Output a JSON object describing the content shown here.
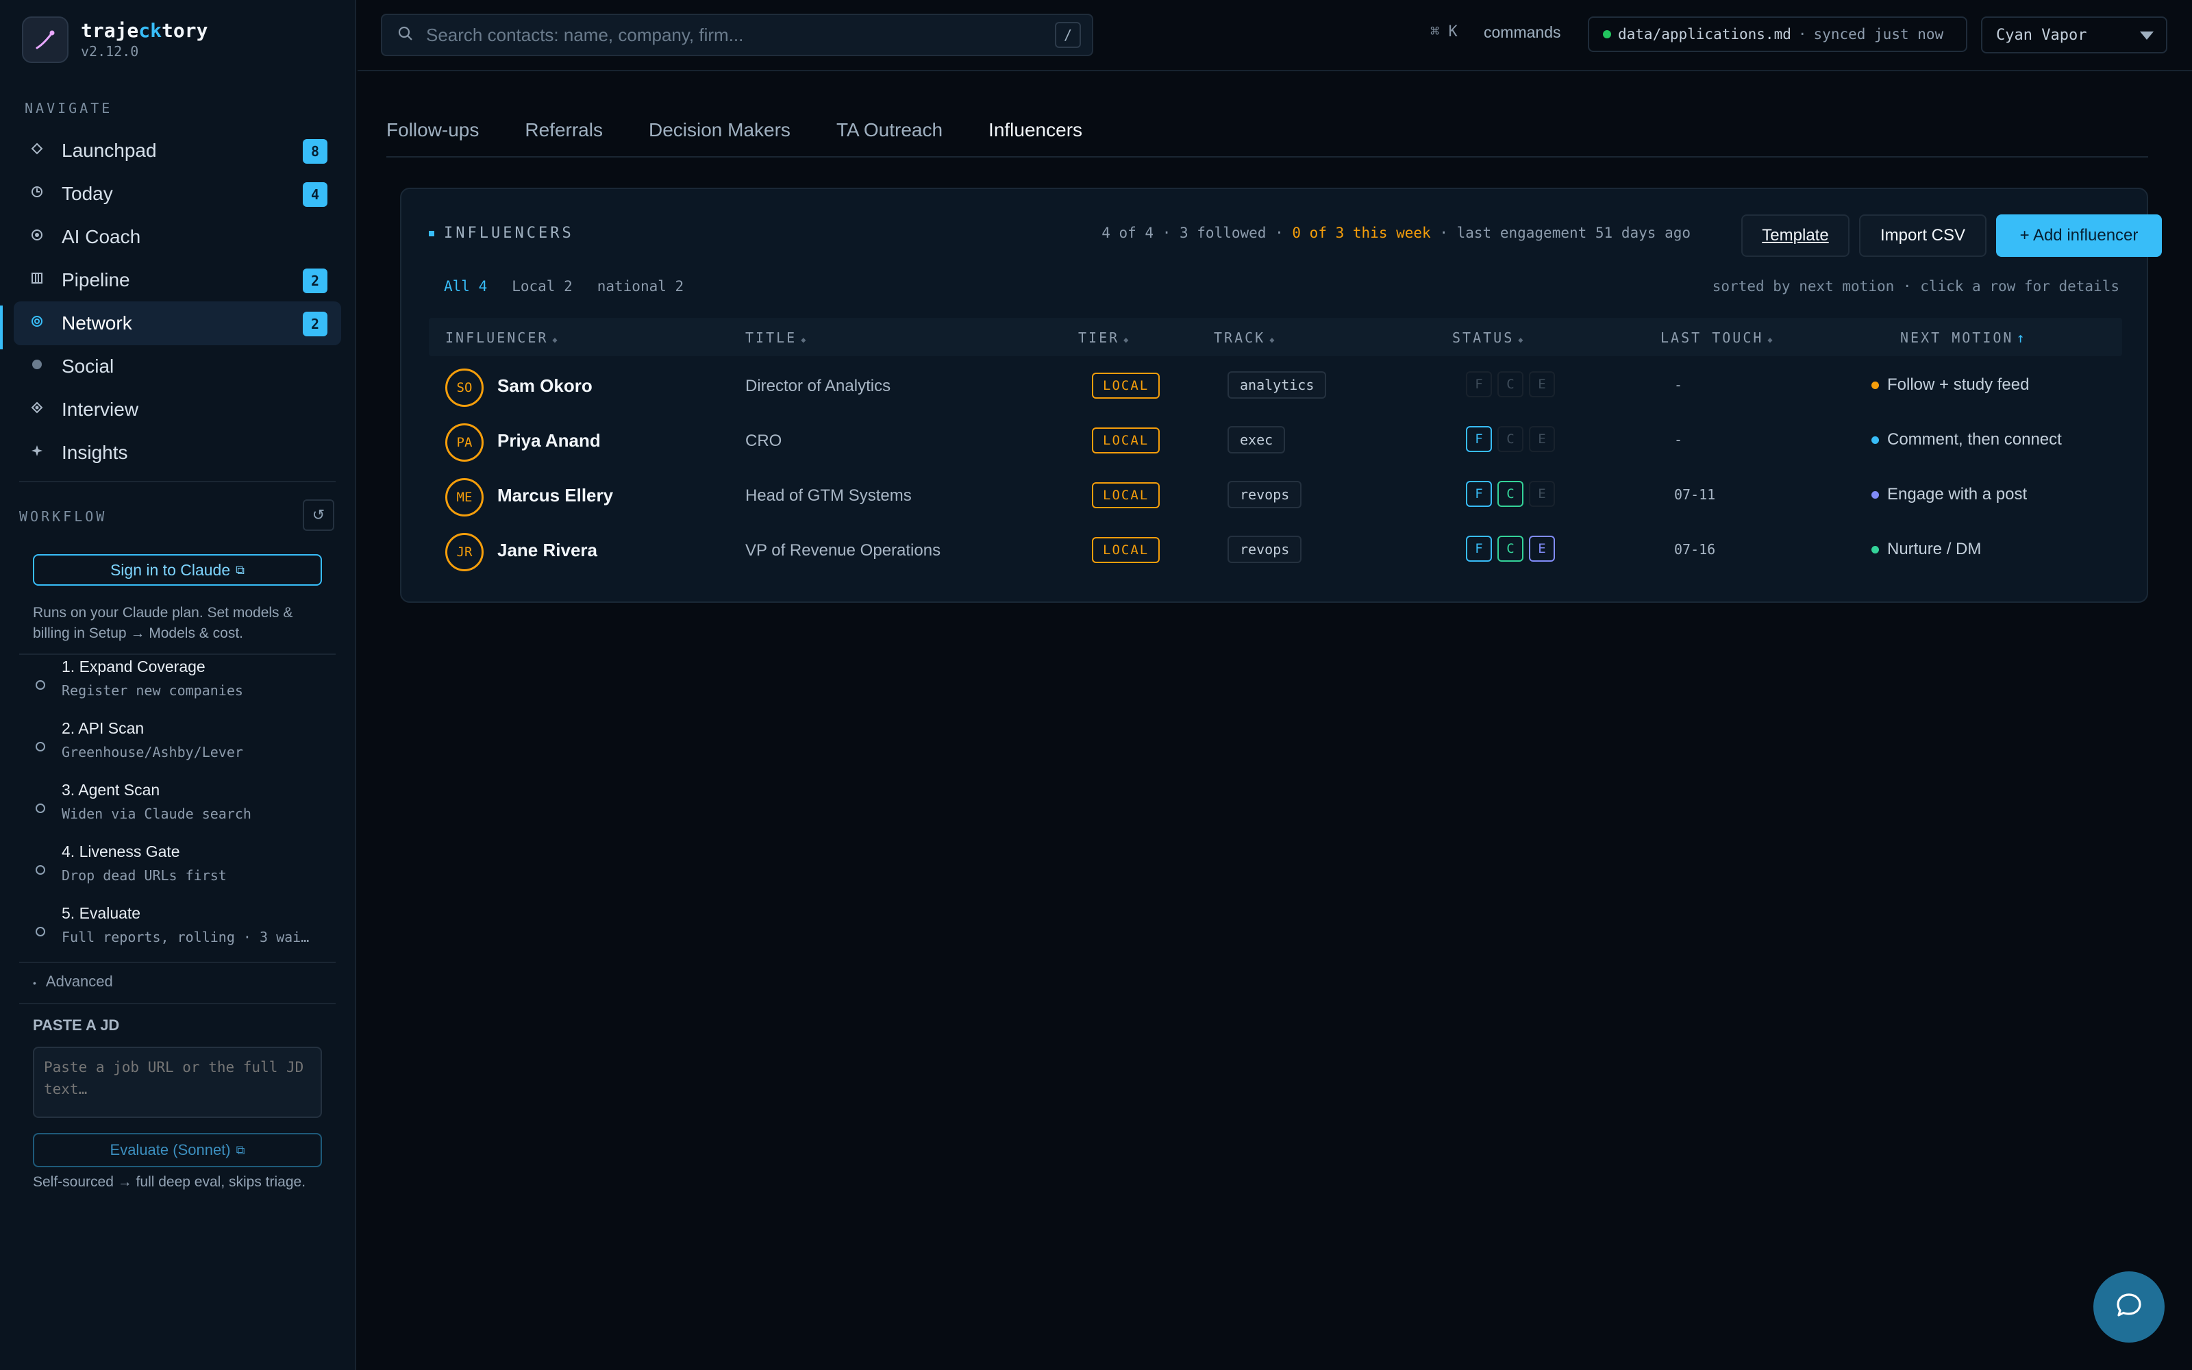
{
  "app": {
    "name_prefix": "traje",
    "name_accent": "ck",
    "name_suffix": "tory",
    "version": "v2.12.0"
  },
  "nav": {
    "label": "NAVIGATE",
    "items": [
      {
        "label": "Launchpad",
        "badge": "8",
        "icon": "diamond-outline-icon"
      },
      {
        "label": "Today",
        "badge": "4",
        "icon": "clock-icon"
      },
      {
        "label": "AI Coach",
        "badge": "",
        "icon": "target-icon"
      },
      {
        "label": "Pipeline",
        "badge": "2",
        "icon": "columns-icon"
      },
      {
        "label": "Network",
        "badge": "2",
        "icon": "network-icon",
        "active": true
      },
      {
        "label": "Social",
        "badge": "",
        "icon": "circle-icon"
      },
      {
        "label": "Interview",
        "badge": "",
        "icon": "diamond-dot-icon"
      },
      {
        "label": "Insights",
        "badge": "",
        "icon": "sparkle-icon"
      }
    ]
  },
  "workflow": {
    "label": "WORKFLOW",
    "signin_label": "Sign in to Claude",
    "note_line1": "Runs on your Claude plan. Set models &",
    "note_line2": "billing in Setup → Models & cost.",
    "steps": [
      {
        "title": "1. Expand Coverage",
        "sub": "Register new companies"
      },
      {
        "title": "2. API Scan",
        "sub": "Greenhouse/Ashby/Lever"
      },
      {
        "title": "3. Agent Scan",
        "sub": "Widen via Claude search"
      },
      {
        "title": "4. Liveness Gate",
        "sub": "Drop dead URLs first"
      },
      {
        "title": "5. Evaluate",
        "sub": "Full reports, rolling · 3 wai…"
      }
    ],
    "advanced_label": "Advanced",
    "paste_label": "PASTE A JD",
    "jd_placeholder": "Paste a job URL or the full JD text…",
    "eval_label": "Evaluate (Sonnet)",
    "self_note": "Self-sourced → full deep eval, skips triage."
  },
  "topbar": {
    "search_placeholder": "Search contacts: name, company, firm...",
    "search_shortcut": "/",
    "cmdk": "⌘ K",
    "commands_label": "commands",
    "sync_file": "data/applications.md",
    "sync_status": "synced just now",
    "theme": "Cyan Vapor"
  },
  "tabs": [
    "Follow-ups",
    "Referrals",
    "Decision Makers",
    "TA Outreach",
    "Influencers"
  ],
  "card": {
    "title": "INFLUENCERS",
    "meta_count": "4 of 4 · 3 followed ·",
    "meta_warn": "0 of 3 this week",
    "meta_tail": "· last engagement 51 days ago",
    "btn_template": "Template",
    "btn_import": "Import CSV",
    "btn_add": "+ Add influencer",
    "filters": [
      "All 4",
      "Local 2",
      "national 2"
    ],
    "sort_hint": "sorted by next motion · click a row for details",
    "columns": [
      "INFLUENCER",
      "TITLE",
      "TIER",
      "TRACK",
      "STATUS",
      "LAST TOUCH",
      "NEXT MOTION"
    ],
    "rows": [
      {
        "initials": "SO",
        "name": "Sam Okoro",
        "title": "Director of Analytics",
        "tier": "LOCAL",
        "track": "analytics",
        "status": [
          "F",
          "C",
          "E"
        ],
        "status_on": [
          false,
          false,
          false
        ],
        "last_touch": "-",
        "next": "Follow + study feed",
        "next_color": "#f59e0b"
      },
      {
        "initials": "PA",
        "name": "Priya Anand",
        "title": "CRO",
        "tier": "LOCAL",
        "track": "exec",
        "status": [
          "F",
          "C",
          "E"
        ],
        "status_on": [
          true,
          false,
          false
        ],
        "last_touch": "-",
        "next": "Comment, then connect",
        "next_color": "#38bdf8"
      },
      {
        "initials": "ME",
        "name": "Marcus Ellery",
        "title": "Head of GTM Systems",
        "tier": "LOCAL",
        "track": "revops",
        "status": [
          "F",
          "C",
          "E"
        ],
        "status_on": [
          true,
          true,
          false
        ],
        "last_touch": "07-11",
        "next": "Engage with a post",
        "next_color": "#818cf8"
      },
      {
        "initials": "JR",
        "name": "Jane Rivera",
        "title": "VP of Revenue Operations",
        "tier": "LOCAL",
        "track": "revops",
        "status": [
          "F",
          "C",
          "E"
        ],
        "status_on": [
          true,
          true,
          true
        ],
        "last_touch": "07-16",
        "next": "Nurture / DM",
        "next_color": "#34d399"
      }
    ]
  }
}
